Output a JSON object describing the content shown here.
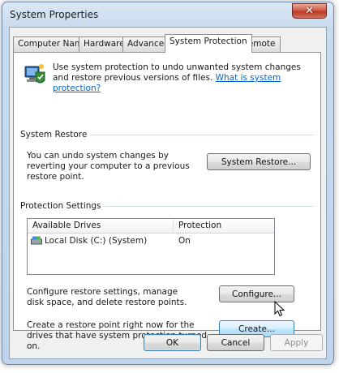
{
  "window": {
    "title": "System Properties",
    "close_glyph": "✕"
  },
  "tabs": [
    {
      "label": "Computer Name"
    },
    {
      "label": "Hardware"
    },
    {
      "label": "Advanced"
    },
    {
      "label": "System Protection"
    },
    {
      "label": "Remote"
    }
  ],
  "intro": {
    "text": "Use system protection to undo unwanted system changes and restore previous versions of files.",
    "link": "What is system protection?"
  },
  "system_restore": {
    "group_label": "System Restore",
    "description": "You can undo system changes by reverting your computer to a previous restore point.",
    "button": "System Restore..."
  },
  "protection_settings": {
    "group_label": "Protection Settings",
    "columns": [
      "Available Drives",
      "Protection"
    ],
    "rows": [
      {
        "drive": "Local Disk (C:) (System)",
        "protection": "On",
        "icon": "drive-icon"
      }
    ],
    "configure_text": "Configure restore settings, manage disk space, and delete restore points.",
    "configure_button": "Configure...",
    "create_text": "Create a restore point right now for the drives that have system protection turned on.",
    "create_button": "Create..."
  },
  "footer": {
    "ok": "OK",
    "cancel": "Cancel",
    "apply": "Apply"
  },
  "colors": {
    "link": "#0066cc",
    "close": "#c8452f",
    "frame": "#c9dbee"
  }
}
